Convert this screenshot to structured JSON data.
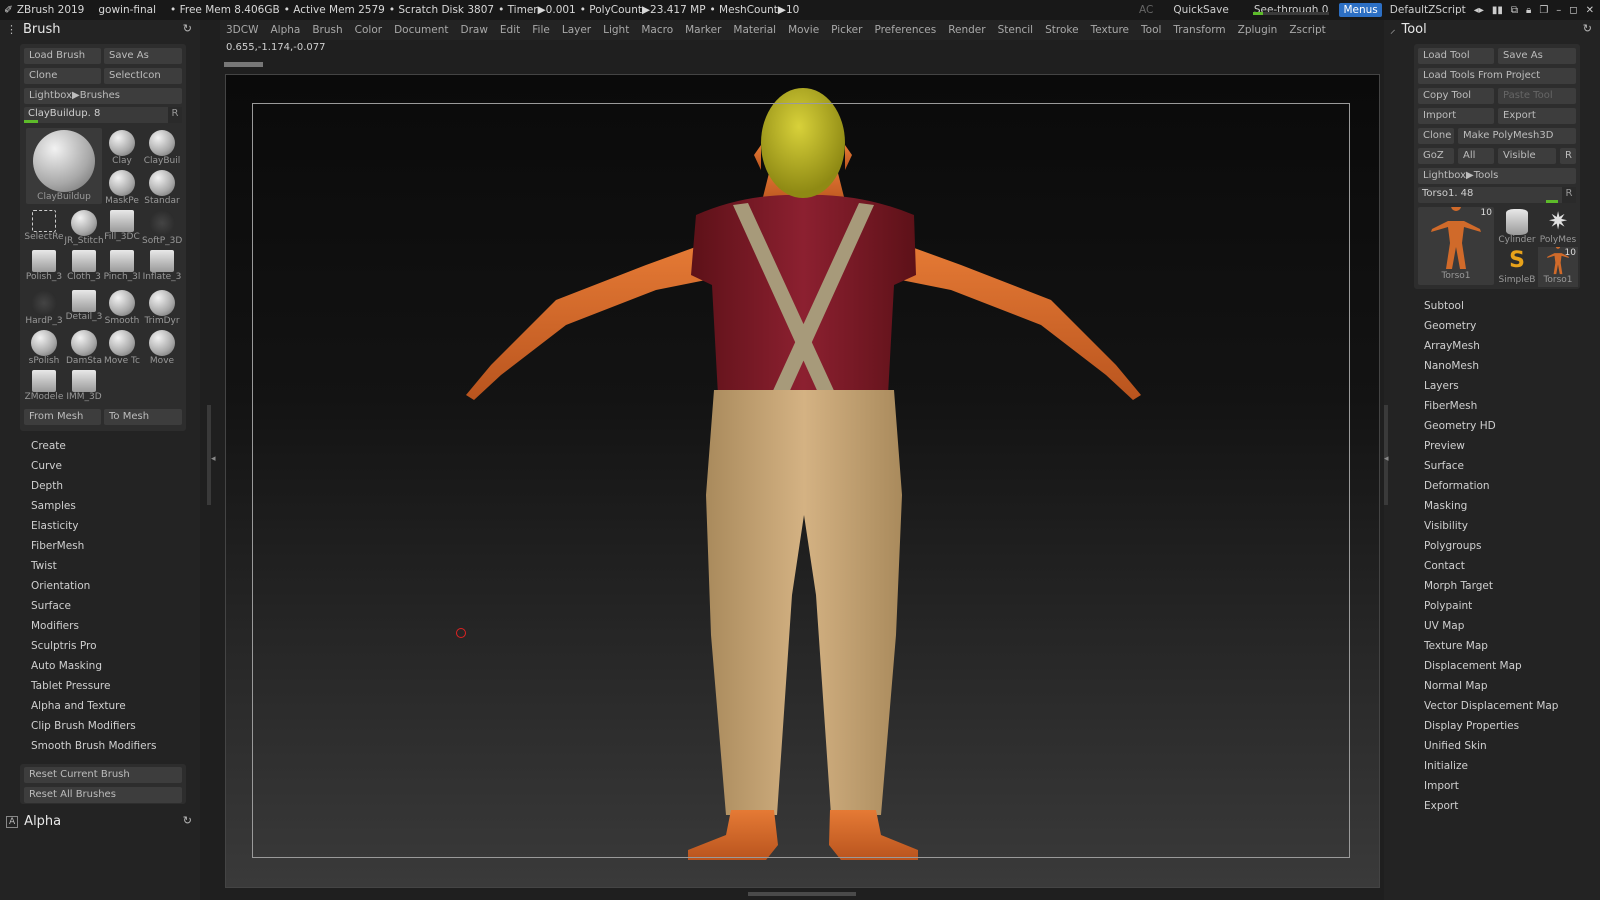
{
  "titlebar": {
    "app": "ZBrush 2019",
    "project": "gowin-final",
    "free_mem": "• Free Mem 8.406GB",
    "active_mem": "• Active Mem 2579",
    "scratch": "• Scratch Disk 3807",
    "timer": "• Timer▶0.001",
    "polycount": "• PolyCount▶23.417 MP",
    "meshcount": "• MeshCount▶10",
    "ac": "AC",
    "quicksave": "QuickSave",
    "seethrough": "See-through  0",
    "menus": "Menus",
    "script": "DefaultZScript"
  },
  "menubar": [
    "3DCW",
    "Alpha",
    "Brush",
    "Color",
    "Document",
    "Draw",
    "Edit",
    "File",
    "Layer",
    "Light",
    "Macro",
    "Marker",
    "Material",
    "Movie",
    "Picker",
    "Preferences",
    "Render",
    "Stencil",
    "Stroke",
    "Texture",
    "Tool",
    "Transform",
    "Zplugin",
    "Zscript"
  ],
  "coords": "0.655,-1.174,-0.077",
  "brush": {
    "title": "Brush",
    "load": "Load Brush",
    "save": "Save As",
    "clone": "Clone",
    "select_icon": "SelectIcon",
    "lightbox": "Lightbox▶Brushes",
    "slider": "ClayBuildup. 8",
    "slider_r": "R",
    "main": "ClayBuildup",
    "thumbs": [
      "Clay",
      "ClayBuil",
      "MaskPe",
      "Standar",
      "SelectRe",
      "JR_Stitch",
      "Fill_3DC",
      "SoftP_3D",
      "Polish_3",
      "Cloth_3",
      "Pinch_3l",
      "Inflate_3",
      "HardP_3",
      "Detail_3",
      "Smooth",
      "TrimDyr",
      "sPolish",
      "DamSta",
      "Move Tc",
      "Move",
      "ZModele",
      "IMM_3D"
    ],
    "from_mesh": "From Mesh",
    "to_mesh": "To Mesh",
    "menu": [
      "Create",
      "Curve",
      "Depth",
      "Samples",
      "Elasticity",
      "FiberMesh",
      "Twist",
      "Orientation",
      "Surface",
      "Modifiers",
      "Sculptris Pro",
      "Auto Masking",
      "Tablet Pressure",
      "Alpha and Texture",
      "Clip Brush Modifiers",
      "Smooth Brush Modifiers"
    ],
    "reset_current": "Reset Current Brush",
    "reset_all": "Reset All Brushes"
  },
  "alpha": {
    "title": "Alpha"
  },
  "tool": {
    "title": "Tool",
    "load": "Load Tool",
    "save": "Save As",
    "load_project": "Load Tools From Project",
    "copy": "Copy Tool",
    "paste": "Paste Tool",
    "import": "Import",
    "export": "Export",
    "clone": "Clone",
    "make_poly": "Make PolyMesh3D",
    "goz": "GoZ",
    "all": "All",
    "visible": "Visible",
    "r": "R",
    "lightbox": "Lightbox▶Tools",
    "slider": "Torso1. 48",
    "slider_r": "R",
    "thumbs": [
      "Torso1",
      "Cylinder",
      "PolyMes",
      "SimpleB",
      "Torso1"
    ],
    "thumb_count": "10",
    "menu": [
      "Subtool",
      "Geometry",
      "ArrayMesh",
      "NanoMesh",
      "Layers",
      "FiberMesh",
      "Geometry HD",
      "Preview",
      "Surface",
      "Deformation",
      "Masking",
      "Visibility",
      "Polygroups",
      "Contact",
      "Morph Target",
      "Polypaint",
      "UV Map",
      "Texture Map",
      "Displacement Map",
      "Normal Map",
      "Vector Displacement Map",
      "Display Properties",
      "Unified Skin",
      "Initialize",
      "Import",
      "Export"
    ]
  },
  "colors": {
    "accent": "#2c6fc4",
    "green": "#5dbb2a",
    "shirt": "#7a1a24",
    "pants": "#c7a676",
    "skin": "#d86a2a",
    "cap": "#b8b01f"
  }
}
